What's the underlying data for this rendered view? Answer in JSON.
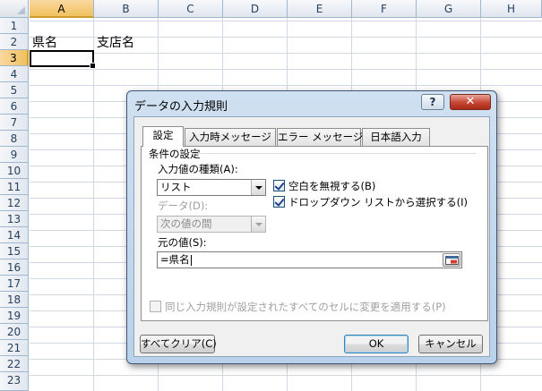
{
  "sheet": {
    "columns": [
      "A",
      "B",
      "C",
      "D",
      "E",
      "F",
      "G",
      "H"
    ],
    "rows": [
      "1",
      "2",
      "3",
      "4",
      "5",
      "6",
      "7",
      "8",
      "9",
      "10",
      "11",
      "12",
      "13",
      "14",
      "15",
      "16",
      "17",
      "18",
      "19",
      "20",
      "21",
      "22",
      "23"
    ],
    "cells": {
      "A2": "県名",
      "B2": "支店名"
    },
    "selected_column": "A",
    "selected_row": "3"
  },
  "dialog": {
    "title": "データの入力規則",
    "help_glyph": "?",
    "close_glyph": "✕",
    "tabs": [
      "設定",
      "入力時メッセージ",
      "エラー メッセージ",
      "日本語入力"
    ],
    "active_tab": "設定",
    "group_label": "条件の設定",
    "allow_label": "入力値の種類(A):",
    "allow_value": "リスト",
    "data_label": "データ(D):",
    "data_value": "次の値の間",
    "ignore_blank_label": "空白を無視する(B)",
    "ignore_blank_checked": true,
    "dropdown_label": "ドロップダウン リストから選択する(I)",
    "dropdown_checked": true,
    "source_label": "元の値(S):",
    "source_value": "=県名",
    "apply_all_label": "同じ入力規則が設定されたすべてのセルに変更を適用する(P)",
    "apply_all_checked": false,
    "clear_all_label": "すべてクリア(C)",
    "ok_label": "OK",
    "cancel_label": "キャンセル"
  }
}
